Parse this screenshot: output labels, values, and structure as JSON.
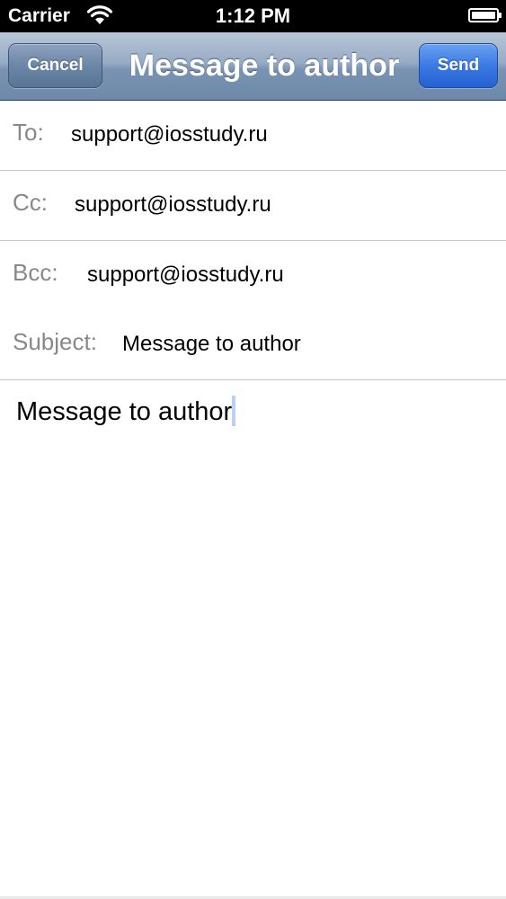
{
  "status_bar": {
    "carrier": "Carrier",
    "time": "1:12 PM",
    "wifi_icon": "wifi-icon",
    "battery_icon": "battery-icon",
    "battery_level": 1.0
  },
  "nav": {
    "title": "Message to author",
    "cancel_label": "Cancel",
    "send_label": "Send"
  },
  "fields": {
    "to": {
      "label": "To:",
      "value": "support@iosstudy.ru"
    },
    "cc": {
      "label": "Cc:",
      "value": "support@iosstudy.ru"
    },
    "bcc": {
      "label": "Bcc:",
      "value": "support@iosstudy.ru"
    },
    "subject": {
      "label": "Subject:",
      "value": "Message to author"
    }
  },
  "body": {
    "text": "Message to author"
  },
  "colors": {
    "nav_bar": "#7a93b2",
    "send_button": "#3a7ae4",
    "label_gray": "#888888",
    "separator": "#c8c8c8"
  }
}
